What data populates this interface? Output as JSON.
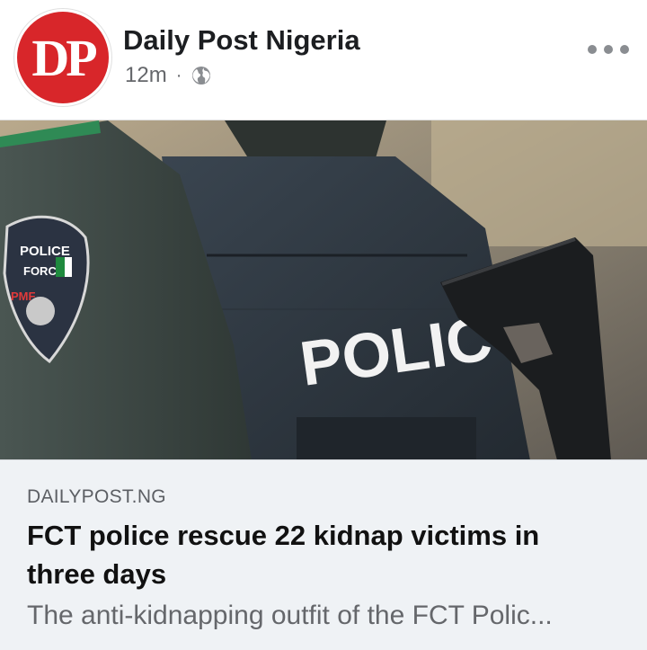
{
  "post": {
    "page_name": "Daily Post Nigeria",
    "avatar_text": "DP",
    "time": "12m",
    "separator": "·",
    "privacy_icon": "globe-icon",
    "more_icon": "more-options-icon"
  },
  "image": {
    "patch_text_1": "POLICE",
    "patch_text_2": "FORCE",
    "patch_text_3": "PMF",
    "vest_text": "POLIC"
  },
  "link_preview": {
    "domain": "DAILYPOST.NG",
    "headline": "FCT police rescue 22 kidnap victims in three days",
    "excerpt": "The anti-kidnapping outfit of the FCT Polic..."
  },
  "colors": {
    "brand_red": "#d8262a",
    "preview_bg": "#eff2f5",
    "meta_text": "#65676b"
  }
}
